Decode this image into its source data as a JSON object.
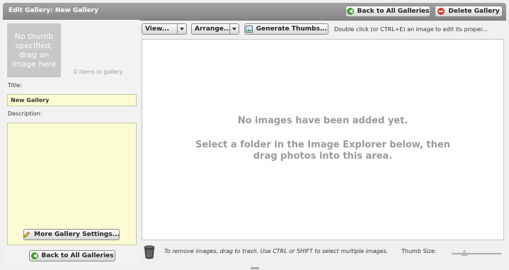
{
  "window": {
    "title": "Edit Gallery: New Gallery"
  },
  "header": {
    "back_label": "Back to All Galleries",
    "delete_label": "Delete Gallery"
  },
  "sidebar": {
    "thumb_placeholder": "No thumb specified; drag an image here",
    "item_count": "0 items in gallery",
    "title_label": "Title:",
    "title_value": "New Gallery",
    "description_label": "Description:",
    "description_value": "",
    "more_settings_label": "More Gallery Settings...",
    "back_label": "Back to All Galleries"
  },
  "toolbar": {
    "view_label": "View...",
    "arrange_label": "Arrange...",
    "generate_label": "Generate Thumbs...",
    "tip": "Double click (or CTRL+E) an image to edit its proper..."
  },
  "main": {
    "empty_title": "No images have been added yet.",
    "empty_hint": "Select a folder in the Image Explorer below, then drag photos into this area."
  },
  "footer": {
    "trash_tip": "To remove images, drag to trash.  Use CTRL or SHIFT to select multiple images.",
    "thumb_size_label": "Thumb Size:",
    "thumb_size_value": 0.25
  }
}
